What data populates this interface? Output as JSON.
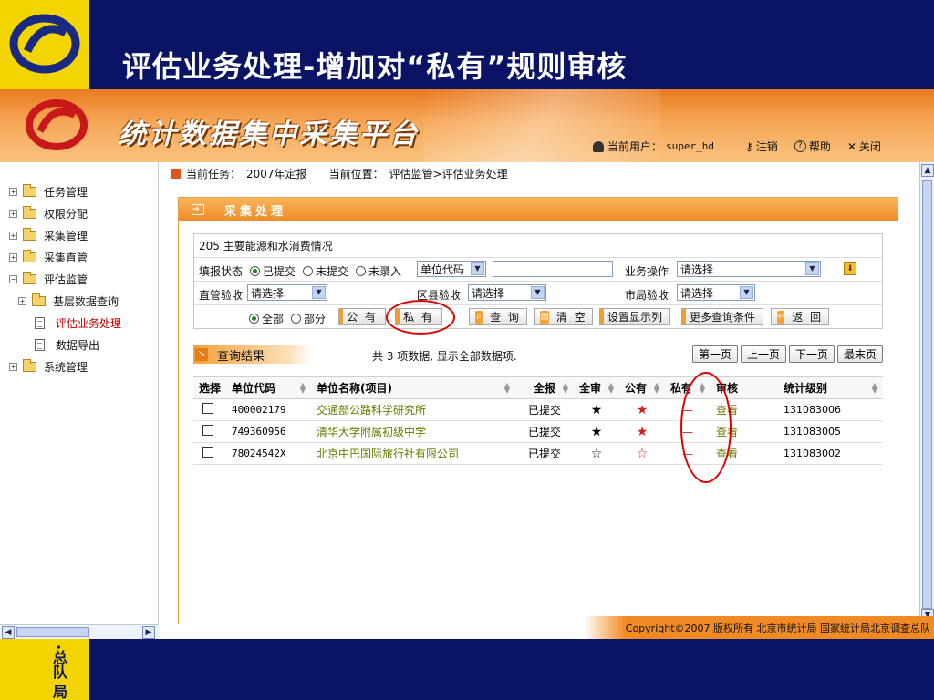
{
  "slide": {
    "title": "评估业务处理-增加对“私有”规则审核",
    "footer_text": "·总队 局"
  },
  "app": {
    "banner_title": "统计数据集中采集平台",
    "current_user_label": "当前用户：",
    "current_user": "super_hd",
    "logout": "注销",
    "help": "帮助",
    "close": "关闭",
    "copyright": "Copyright©2007 版权所有 北京市统计局 国家统计局北京调查总队"
  },
  "sidebar": {
    "items": [
      {
        "label": "任务管理"
      },
      {
        "label": "权限分配"
      },
      {
        "label": "采集管理"
      },
      {
        "label": "采集直管"
      },
      {
        "label": "评估监管"
      },
      {
        "label": "基层数据查询"
      },
      {
        "label": "评估业务处理"
      },
      {
        "label": "数据导出"
      },
      {
        "label": "系统管理"
      }
    ]
  },
  "breadcrumb": {
    "task_label": "当前任务：",
    "task": "2007年定报",
    "pos_label": "当前位置：",
    "pos": "评估监管>评估业务处理"
  },
  "panel": {
    "title": "采集处理",
    "report": "205 主要能源和水消费情况",
    "fill_status_label": "填报状态",
    "fill_status_options": [
      "已提交",
      "未提交",
      "未录入"
    ],
    "unit_code_select": "单位代码",
    "business_op_label": "业务操作",
    "business_op_value": "请选择",
    "direct_check_label": "直管验收",
    "direct_check_value": "请选择",
    "district_check_label": "区县验收",
    "district_check_value": "请选择",
    "city_check_label": "市局验收",
    "city_check_value": "请选择",
    "scope_all": "全部",
    "scope_part": "部分",
    "btn_public": "公 有",
    "btn_private": "私 有",
    "btn_query": "查 询",
    "btn_clear": "清 空",
    "btn_columns": "设置显示列",
    "btn_more": "更多查询条件",
    "btn_back": "返 回"
  },
  "results": {
    "title": "查询结果",
    "info": "共 3 项数据, 显示全部数据项.",
    "pager": [
      "第一页",
      "上一页",
      "下一页",
      "最末页"
    ],
    "columns": [
      "选择",
      "单位代码",
      "单位名称(项目)",
      "全报",
      "全审",
      "公有",
      "私有",
      "审核",
      "统计级别"
    ],
    "rows": [
      {
        "code": "400002179",
        "name": "交通部公路科学研究所",
        "status": "已提交",
        "private": "—",
        "audit": "查看",
        "level": "131083006"
      },
      {
        "code": "749360956",
        "name": "清华大学附属初级中学",
        "status": "已提交",
        "private": "—",
        "audit": "查看",
        "level": "131083005"
      },
      {
        "code": "78024542X",
        "name": "北京中巴国际旅行社有限公司",
        "status": "已提交",
        "private": "—",
        "audit": "查看",
        "level": "131083002"
      }
    ]
  },
  "colors": {
    "slide_bg": "#0b1464",
    "logo_yellow": "#f2d400",
    "banner_orange": "#f08a24",
    "annotation_red": "#e00000"
  }
}
